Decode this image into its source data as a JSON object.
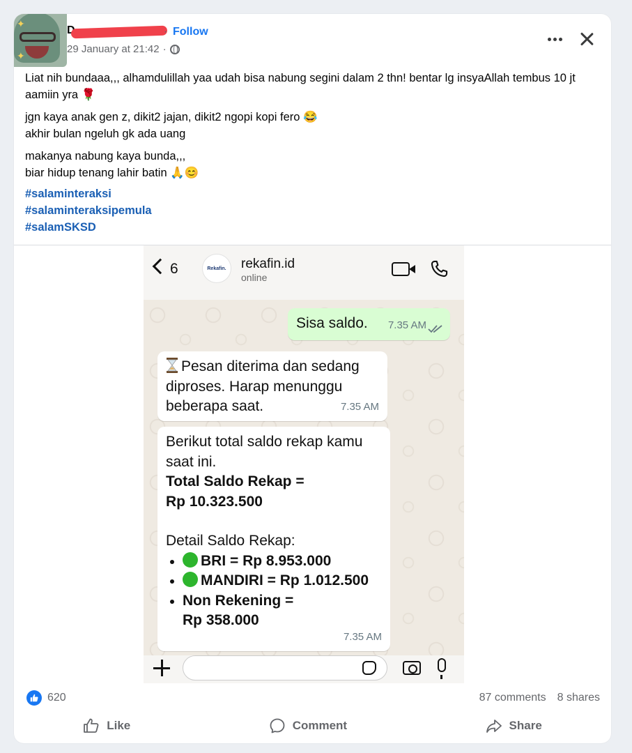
{
  "post": {
    "author_initial": "D",
    "follow_label": "Follow",
    "timestamp": "29 January at 21:42",
    "paragraphs": [
      "Liat nih bundaaa,,, alhamdulillah yaa udah bisa nabung segini dalam 2 thn! bentar lg insyaAllah tembus 10 jt aamiin yra 🌹",
      "jgn kaya anak gen z, dikit2 jajan, dikit2 ngopi kopi fero 😂\nakhir bulan ngeluh gk ada uang",
      "makanya nabung kaya bunda,,,\nbiar hidup tenang lahir batin 🙏😊"
    ],
    "hashtags": [
      "#salaminteraksi",
      "#salaminteraksipemula",
      "#salamSKSD"
    ]
  },
  "chat": {
    "back_count": "6",
    "contact_name": "rekafin.id",
    "contact_status": "online",
    "avatar_text": "Rekafin.",
    "outgoing": {
      "text": "Sisa saldo.",
      "time": "7.35 AM"
    },
    "incoming1": {
      "text": "Pesan diterima dan sedang diproses. Harap menunggu beberapa saat.",
      "time": "7.35 AM"
    },
    "incoming2": {
      "intro": "Berikut total saldo rekap kamu saat ini.",
      "total_label": "Total Saldo Rekap =",
      "total_value": "Rp 10.323.500",
      "detail_label": "Detail Saldo Rekap:",
      "items": [
        {
          "text": "BRI = Rp 8.953.000"
        },
        {
          "text": "MANDIRI = Rp 1.012.500"
        },
        {
          "text": "Non Rekening =\nRp 358.000"
        }
      ],
      "time": "7.35 AM"
    },
    "input_placeholder": ""
  },
  "footer": {
    "like_count": "620",
    "comments": "87 comments",
    "shares": "8 shares",
    "like_label": "Like",
    "comment_label": "Comment",
    "share_label": "Share"
  },
  "colors": {
    "link_blue": "#1877f2",
    "hashtag_blue": "#1a5fb4",
    "outgoing_bubble": "#d9fdd3",
    "chat_bg": "#efeae2",
    "green_dot": "#2db52d"
  }
}
